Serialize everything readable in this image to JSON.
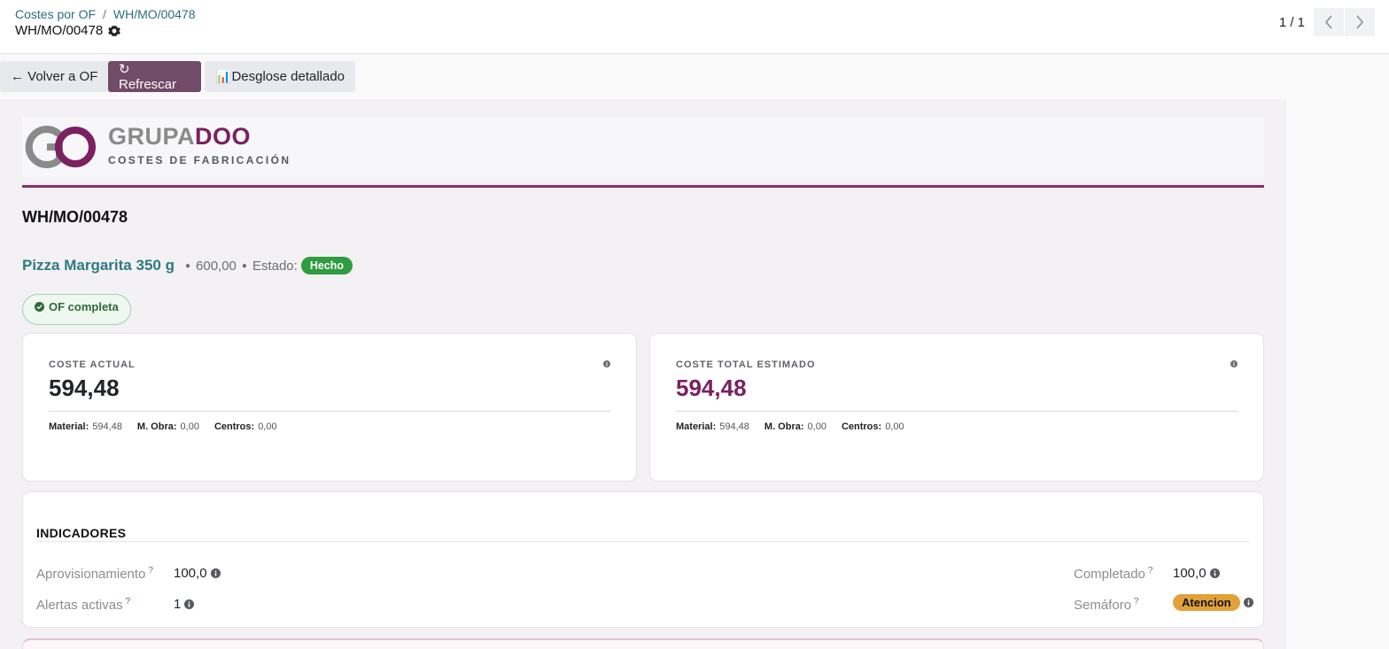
{
  "breadcrumb": {
    "parent": "Costes por OF",
    "separator": "/",
    "current": "WH/MO/00478"
  },
  "record": {
    "title": "WH/MO/00478",
    "gear_icon": "gear-icon"
  },
  "pager": {
    "value": "1 / 1",
    "prev_icon": "chevron-left-icon",
    "next_icon": "chevron-right-icon"
  },
  "toolbar": {
    "back_label": "← Volver a OF",
    "refresh_label": "↻ Refrescar",
    "breakdown_label": "Desglose detallado",
    "breakdown_icon": "📊"
  },
  "header": {
    "brand_part1": "GRUPA",
    "brand_part2": "DOO",
    "subtitle": "COSTES DE FABRICACIÓN"
  },
  "mo": {
    "title": "WH/MO/00478",
    "product": "Pizza Margarita 350 g",
    "quantity": "600,00",
    "state_label": "Estado:",
    "state_value": "Hecho",
    "completion_badge": "OF completa"
  },
  "cards": [
    {
      "label": "COSTE ACTUAL",
      "value": "594,48",
      "value_color": "#212529",
      "material_label": "Material:",
      "material": "594,48",
      "labor_label": "M. Obra:",
      "labor": "0,00",
      "centers_label": "Centros:",
      "centers": "0,00"
    },
    {
      "label": "COSTE TOTAL ESTIMADO",
      "value": "594,48",
      "value_color": "#7b2060",
      "material_label": "Material:",
      "material": "594,48",
      "labor_label": "M. Obra:",
      "labor": "0,00",
      "centers_label": "Centros:",
      "centers": "0,00"
    }
  ],
  "indicators": {
    "title": "INDICADORES",
    "provisioning_label": "Aprovisionamiento",
    "provisioning_value": "100,0",
    "alerts_label": "Alertas activas",
    "alerts_value": "1",
    "completed_label": "Completado",
    "completed_value": "100,0",
    "semaforo_label": "Semáforo",
    "semaforo_value": "Atencion",
    "help_mark": "?"
  },
  "colors": {
    "primary": "#714b67",
    "brand": "#7b2060",
    "success": "#2e9c3f",
    "warning": "#e2a23a",
    "link": "#2e7a82"
  }
}
